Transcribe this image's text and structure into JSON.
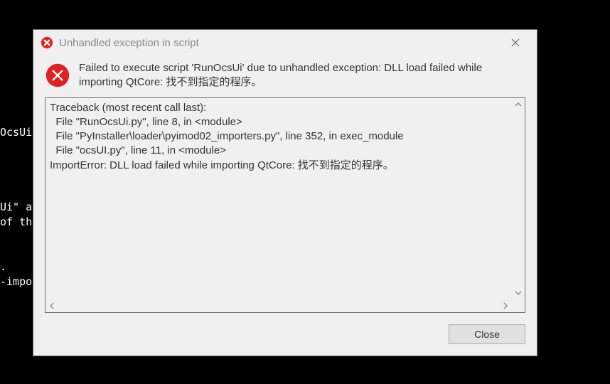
{
  "background_terminal": "\nOcsUi\n\n\n\n\nUi\" a\nof th\n\n\n.\n-impo",
  "dialog": {
    "title": "Unhandled exception in script",
    "header_message": "Failed to execute script 'RunOcsUi' due to unhandled exception: DLL load failed while importing QtCore: 找不到指定的程序。",
    "traceback": "Traceback (most recent call last):\n  File \"RunOcsUi.py\", line 8, in <module>\n  File \"PyInstaller\\loader\\pyimod02_importers.py\", line 352, in exec_module\n  File \"ocsUI.py\", line 11, in <module>\nImportError: DLL load failed while importing QtCore: 找不到指定的程序。",
    "close_button_label": "Close"
  },
  "icons": {
    "title_error": "error-icon",
    "header_error": "error-icon"
  },
  "colors": {
    "error_red": "#d22",
    "dialog_bg": "#f0f0f0",
    "border": "#707070"
  }
}
